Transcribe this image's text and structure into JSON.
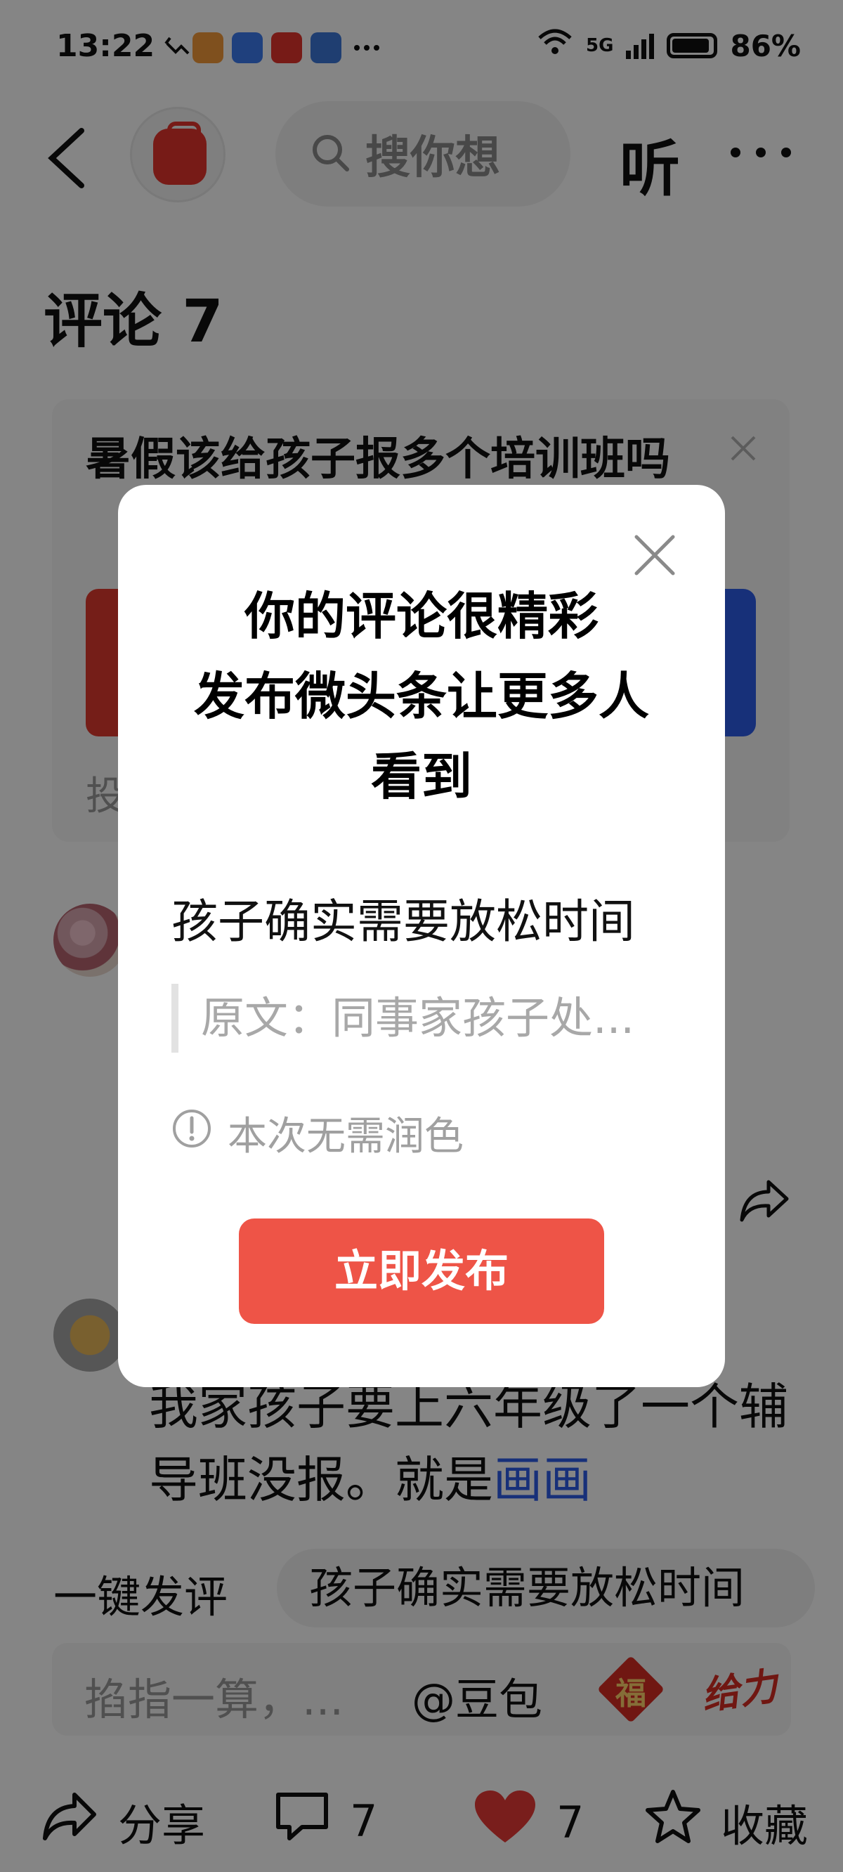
{
  "status_bar": {
    "time": "13:22",
    "network": "5G",
    "battery": "86%"
  },
  "nav": {
    "search_placeholder": "搜你想",
    "listen_label": "听"
  },
  "comments": {
    "title": "评论 7"
  },
  "poll": {
    "question": "暑假该给孩子报多个培训班吗",
    "footer": "投"
  },
  "comment_preview": {
    "text": "我家孩子要上六年级了一个辅导班没报。就是",
    "link": "画画"
  },
  "quick_comment": {
    "label": "一键发评",
    "chip": "孩子确实需要放松时间"
  },
  "input_bar": {
    "placeholder": "掐指一算，...",
    "doubao": "@豆包",
    "fu": "福",
    "geili": "给力"
  },
  "bottom_bar": {
    "share": "分享",
    "comments": "7",
    "likes": "7",
    "favorite": "收藏"
  },
  "modal": {
    "title_lines": [
      "你的评论很精彩",
      "发布微头条让更多人",
      "看到"
    ],
    "comment": "孩子确实需要放松时间",
    "original": "原文：同事家孩子处...",
    "note": "本次无需润色",
    "publish_button": "立即发布"
  },
  "colors": {
    "accent_red": "#ee5447",
    "link_blue": "#2d5de8",
    "overlay": "rgba(0,0,0,0.48)"
  }
}
